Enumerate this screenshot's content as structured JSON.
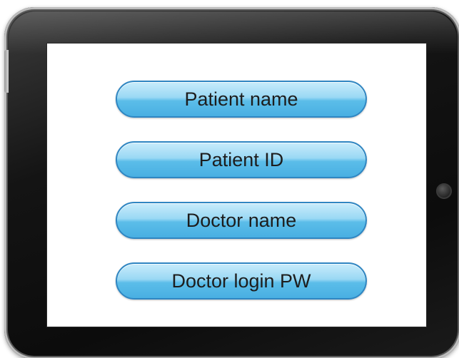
{
  "buttons": [
    {
      "label": "Patient name"
    },
    {
      "label": "Patient ID"
    },
    {
      "label": "Doctor name"
    },
    {
      "label": "Doctor login PW"
    }
  ],
  "colors": {
    "button_fill": "#5bbde9",
    "button_border": "#2f86c2",
    "bezel": "#141414",
    "screen": "#ffffff"
  },
  "icons": {
    "home_button": "home-button-icon"
  }
}
